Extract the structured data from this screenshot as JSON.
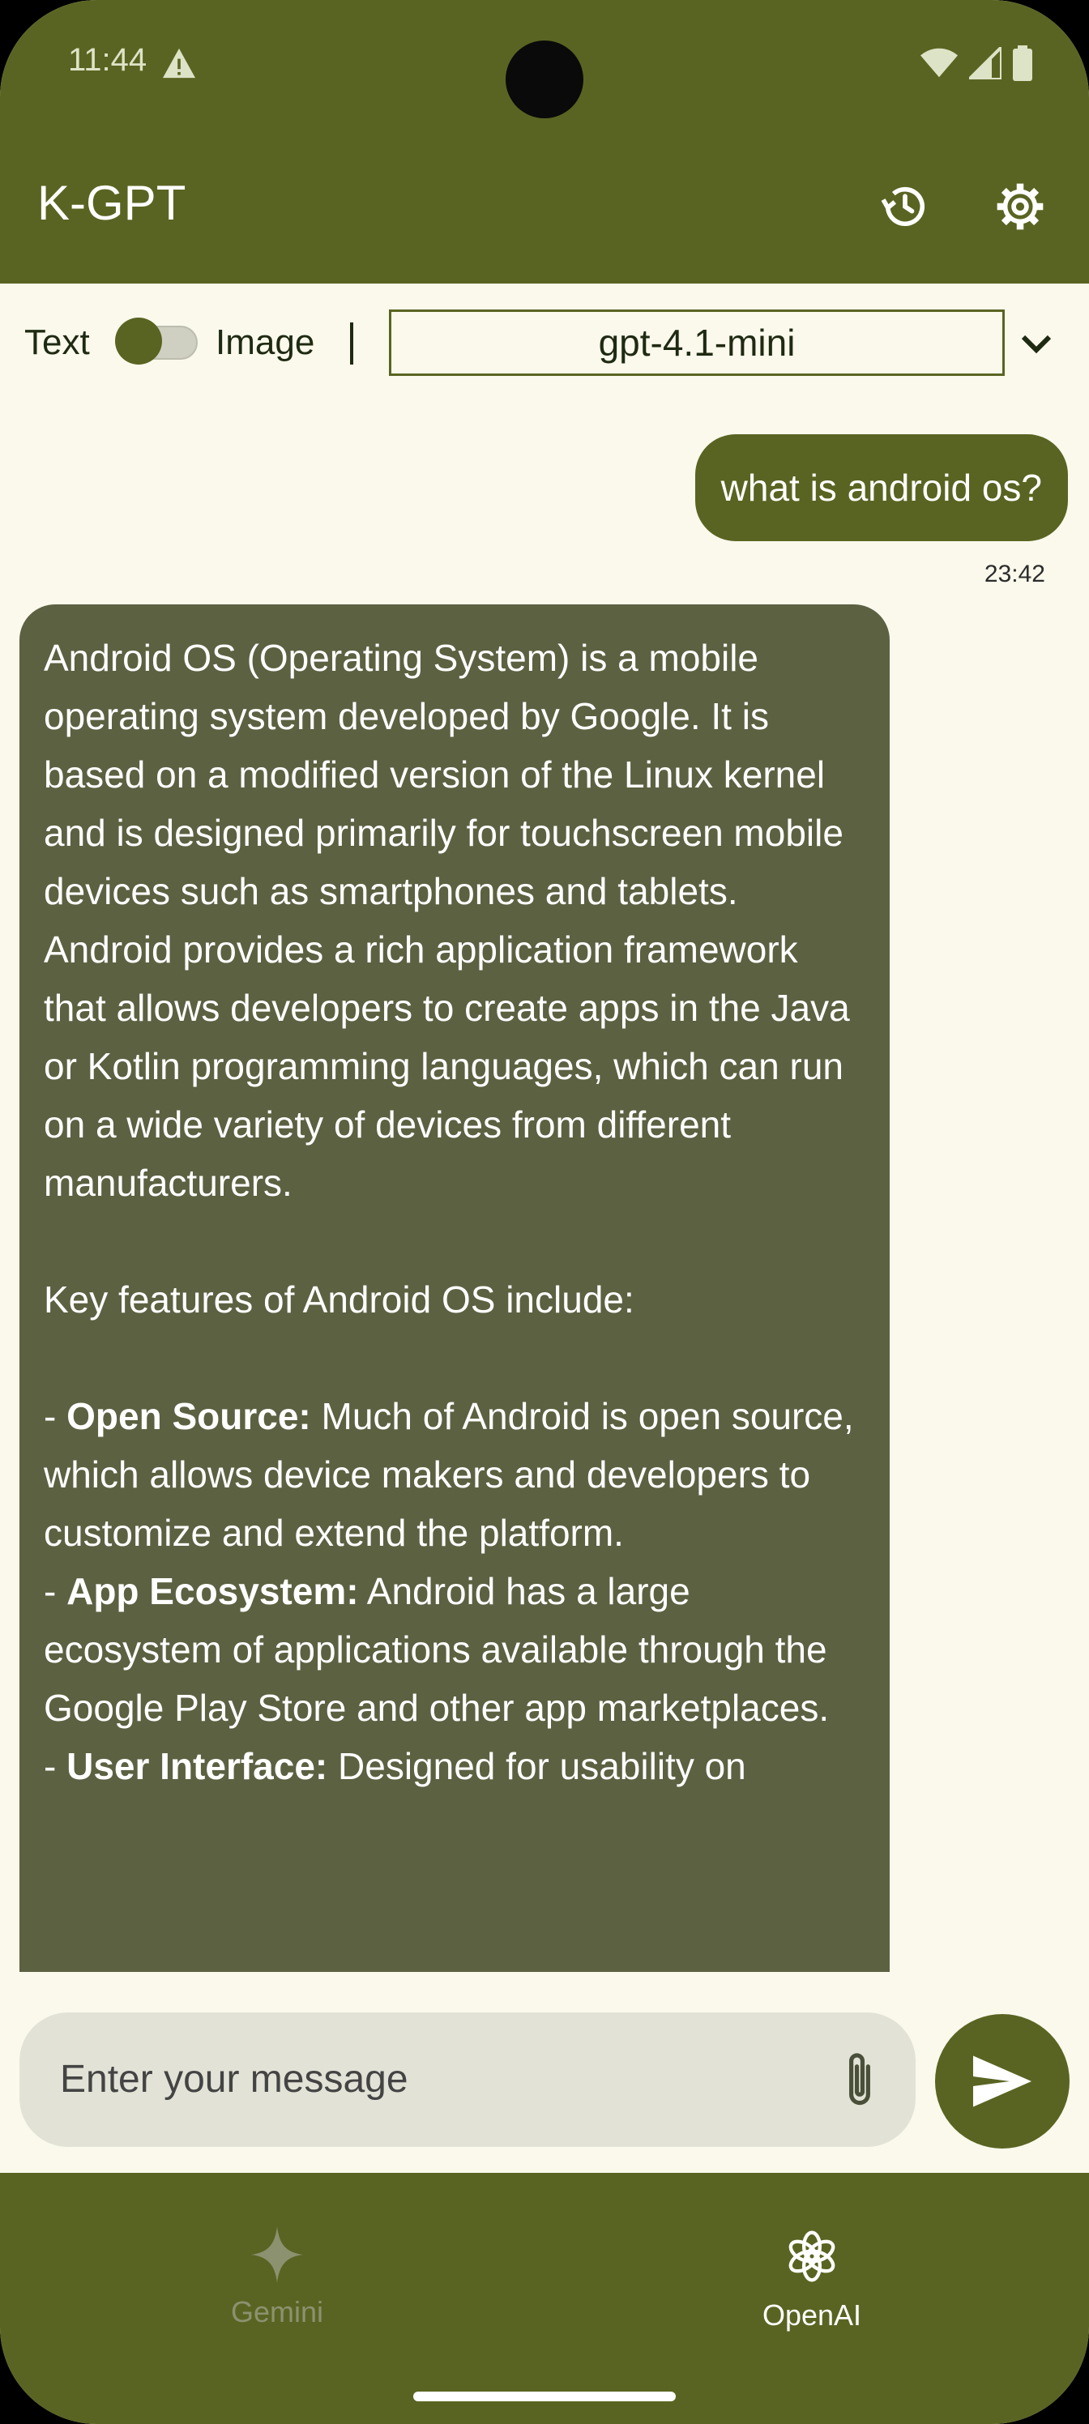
{
  "status_bar": {
    "time": "11:44"
  },
  "app_bar": {
    "title": "K-GPT"
  },
  "controls": {
    "mode_left": "Text",
    "mode_right": "Image",
    "separator": "|",
    "model": "gpt-4.1-mini"
  },
  "chat": {
    "user_message": "what is android os?",
    "timestamp": "23:42",
    "reply": {
      "intro": "Android OS (Operating System) is a mobile operating system developed by Google. It is based on a modified version of the Linux kernel and is designed primarily for touchscreen mobile devices such as smartphones and tablets. Android provides a rich application framework that allows developers to create apps in the Java or Kotlin programming languages, which can run on a wide variety of devices from different manufacturers.",
      "features_heading": "Key features of Android OS include:",
      "features": [
        {
          "title": "Open Source:",
          "text": " Much of Android is open source, which allows device makers and developers to customize and extend the platform."
        },
        {
          "title": "App Ecosystem:",
          "text": " Android has a large ecosystem of applications available through the Google Play Store and other app marketplaces."
        },
        {
          "title": "User Interface:",
          "text": " Designed for usability on"
        }
      ]
    }
  },
  "input": {
    "placeholder": "Enter your message"
  },
  "bottom_nav": {
    "items": [
      {
        "label": "Gemini",
        "icon": "gemini-icon",
        "active": false
      },
      {
        "label": "OpenAI",
        "icon": "openai-icon",
        "active": true
      }
    ]
  },
  "colors": {
    "primary": "#5A6422",
    "background": "#FAF9EC",
    "bot_bubble": "#5C6142",
    "input_bg": "#E2E3D6"
  }
}
